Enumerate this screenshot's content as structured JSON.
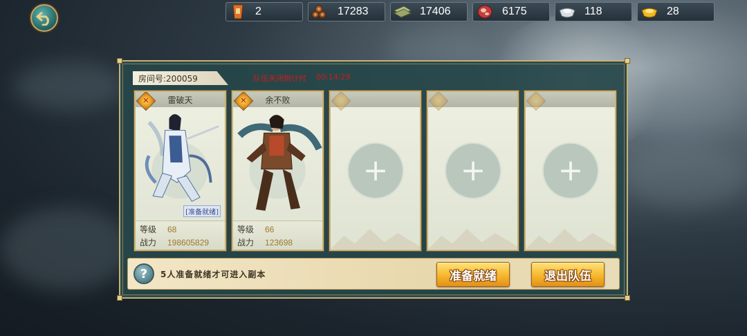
{
  "resources": [
    {
      "icon": "token-icon",
      "value": "2"
    },
    {
      "icon": "wood-icon",
      "value": "17283"
    },
    {
      "icon": "cash-icon",
      "value": "17406"
    },
    {
      "icon": "meat-icon",
      "value": "6175"
    },
    {
      "icon": "silver-icon",
      "value": "118"
    },
    {
      "icon": "gold-icon",
      "value": "28"
    }
  ],
  "room": {
    "label": "房间号:200059",
    "countdown_label": "队伍关闭倒计时",
    "countdown_value": "00:14:29"
  },
  "members": [
    {
      "name": "雷破天",
      "ready_tag": "[准备就绪]",
      "level_label": "等级",
      "level": "68",
      "power_label": "战力",
      "power": "198605829"
    },
    {
      "name": "余不败",
      "level_label": "等级",
      "level": "66",
      "power_label": "战力",
      "power": "123698"
    }
  ],
  "empty_slot_symbol": "+",
  "footer": {
    "help_symbol": "?",
    "hint": "5人准备就绪才可进入副本",
    "ready_button": "准备就绪",
    "leave_button": "退出队伍"
  },
  "colors": {
    "gold_button": "#f6b72d",
    "countdown": "#c81e1e",
    "panel": "#26464a"
  }
}
